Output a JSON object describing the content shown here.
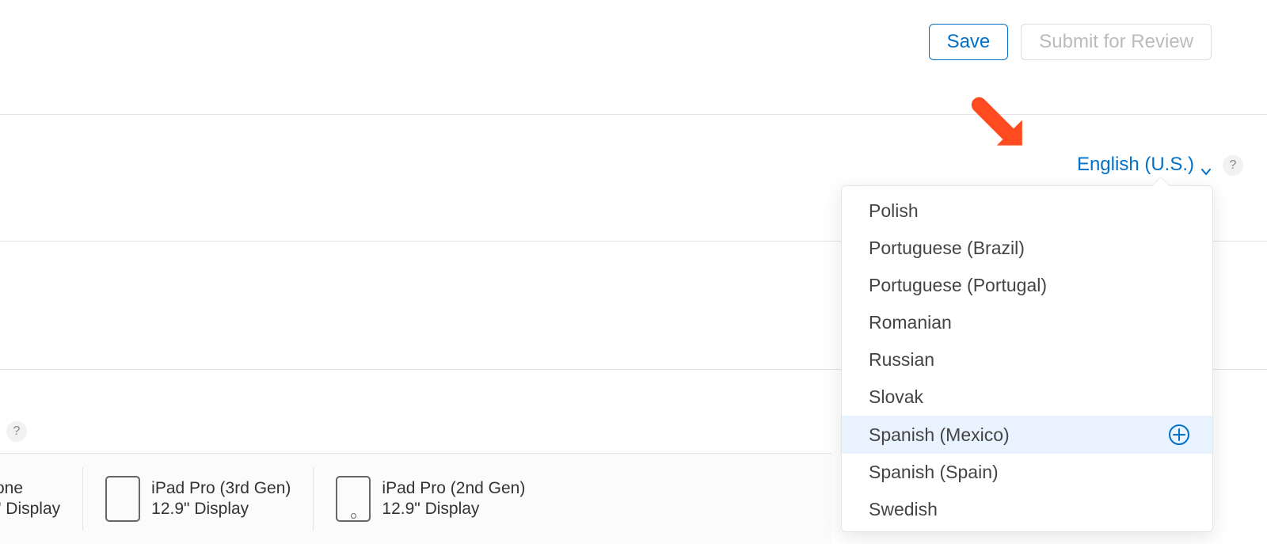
{
  "actions": {
    "save_label": "Save",
    "submit_label": "Submit for Review"
  },
  "language": {
    "selected": "English (U.S.)",
    "menu": [
      {
        "label": "Polish"
      },
      {
        "label": "Portuguese (Brazil)"
      },
      {
        "label": "Portuguese (Portugal)"
      },
      {
        "label": "Romanian"
      },
      {
        "label": "Russian"
      },
      {
        "label": "Slovak"
      },
      {
        "label": "Spanish (Mexico)",
        "hover": true
      },
      {
        "label": "Spanish (Spain)"
      },
      {
        "label": "Swedish"
      }
    ]
  },
  "help_glyph": "?",
  "devices": [
    {
      "name_line1": "one",
      "name_line2": "\" Display",
      "glyph": "phone",
      "cutoff": true
    },
    {
      "name_line1": "iPad Pro (3rd Gen)",
      "name_line2": "12.9\" Display",
      "glyph": "tablet",
      "cutoff": false
    },
    {
      "name_line1": "iPad Pro (2nd Gen)",
      "name_line2": "12.9\" Display",
      "glyph": "tablet-home",
      "cutoff": false
    }
  ],
  "colors": {
    "accent": "#0070c9",
    "arrow": "#ff4b1f",
    "menu_hover_bg": "#e8f3ff"
  }
}
